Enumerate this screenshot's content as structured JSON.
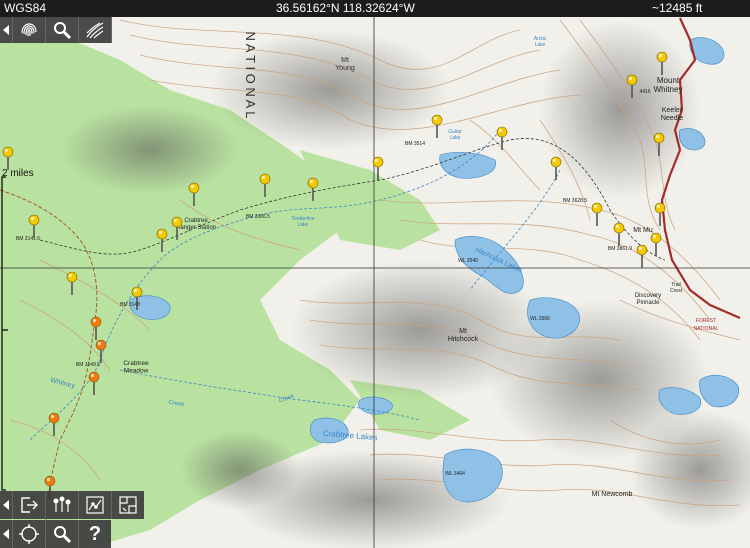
{
  "status_bar": {
    "datum": "WGS84",
    "coordinates": "36.56162°N 118.32624°W",
    "elevation": "~12485 ft"
  },
  "scale": {
    "label": "2 miles"
  },
  "map": {
    "colors": {
      "paper": "#f2f0ea",
      "forest": "#b9e2a0",
      "contour": "#c9a27e",
      "water": "#8fc1e6",
      "trail": "#a52a2a",
      "pin_yellow": "#f5c800",
      "pin_orange": "#f07a10"
    },
    "labels": [
      {
        "id": "mt-young",
        "text": "Mt\nYoung"
      },
      {
        "id": "mount-whitney",
        "text": "Mount\nWhitney"
      },
      {
        "id": "keeler-needle",
        "text": "Keeler\nNeedle"
      },
      {
        "id": "crabtree-ranger",
        "text": "Crabtree\nRanger Station"
      },
      {
        "id": "crabtree-meadow",
        "text": "Crabtree\nMeadow"
      },
      {
        "id": "mt-hitchcock",
        "text": "Mt\nHitchcock"
      },
      {
        "id": "discovery-pinnacle",
        "text": "Discovery\nPinnacle"
      },
      {
        "id": "mt-newcomb",
        "text": "Mt Newcomb"
      },
      {
        "id": "hitchcock-lakes",
        "text": "Hitchcock Lakes"
      },
      {
        "id": "crabtree-lakes",
        "text": "Crabtree Lakes"
      },
      {
        "id": "guitar-lake",
        "text": "Guitar\nLake"
      },
      {
        "id": "timberline-lake",
        "text": "Timberline\nLake"
      },
      {
        "id": "whitney-creek",
        "text": "Whitney"
      },
      {
        "id": "creek-1",
        "text": "Creek"
      },
      {
        "id": "creek-2",
        "text": "Creek"
      },
      {
        "id": "wl-3540",
        "text": "WL 3540"
      },
      {
        "id": "wl-3566",
        "text": "WL 3566"
      },
      {
        "id": "wl-3464",
        "text": "WL 3464"
      },
      {
        "id": "national",
        "text": "N A T I O N A L"
      },
      {
        "id": "bm-3514",
        "text": "BM 3514"
      },
      {
        "id": "bm-3628",
        "text": "BM 3628.5"
      },
      {
        "id": "bm-3306",
        "text": "BM 3306.5"
      },
      {
        "id": "bm-3141",
        "text": "BM 3141.6"
      },
      {
        "id": "bm-3149",
        "text": "BM 3149.5"
      },
      {
        "id": "bm-3148",
        "text": "BM 3148"
      },
      {
        "id": "bm-3861",
        "text": "BM 3861.9"
      },
      {
        "id": "mt-mu",
        "text": "Mt Mu"
      },
      {
        "id": "forest",
        "text": "FOREST"
      },
      {
        "id": "national-2",
        "text": "NATIONAL"
      },
      {
        "id": "trail-crest",
        "text": "Trail\nCrest"
      },
      {
        "id": "mt-4416",
        "text": "4416"
      },
      {
        "id": "arctic-lake",
        "text": "Arctic\nLake"
      }
    ],
    "waypoint_count_note": ""
  },
  "toolbar_top": [
    {
      "name": "fingerprint-icon"
    },
    {
      "name": "search-magnifier-icon"
    },
    {
      "name": "contour-lines-icon"
    }
  ],
  "toolbar_bottom_row1": [
    {
      "name": "export-icon"
    },
    {
      "name": "waypoints-icon"
    },
    {
      "name": "track-edit-icon"
    },
    {
      "name": "map-layers-icon"
    }
  ],
  "toolbar_bottom_row2": [
    {
      "name": "gps-locate-icon"
    },
    {
      "name": "search-icon"
    },
    {
      "name": "help-icon",
      "glyph": "?"
    }
  ]
}
